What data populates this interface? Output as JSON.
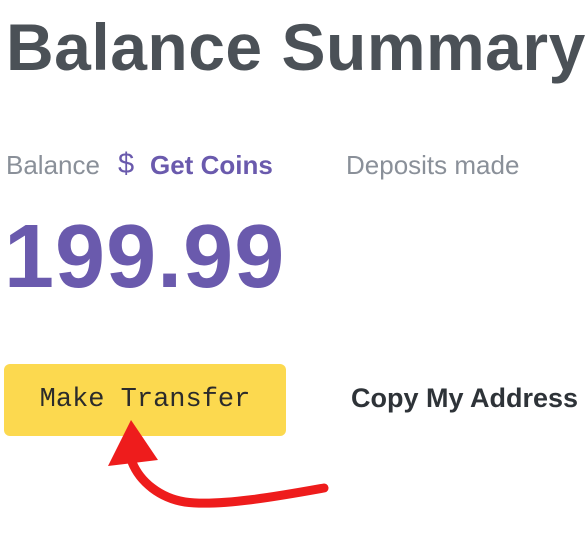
{
  "header": {
    "title": "Balance Summary"
  },
  "balance": {
    "label": "Balance",
    "currency_icon": "dollar-icon",
    "currency_symbol": "$",
    "get_coins_label": "Get Coins",
    "value": "199.99"
  },
  "deposits": {
    "label": "Deposits made"
  },
  "actions": {
    "make_transfer_label": "Make Transfer",
    "copy_address_label": "Copy My Address"
  },
  "annotation": {
    "icon": "arrow-annotation-icon",
    "color": "#ee1c1c"
  },
  "colors": {
    "accent": "#6a5aad",
    "button": "#fcd94f",
    "title": "#4b5157",
    "muted": "#8a9099"
  }
}
